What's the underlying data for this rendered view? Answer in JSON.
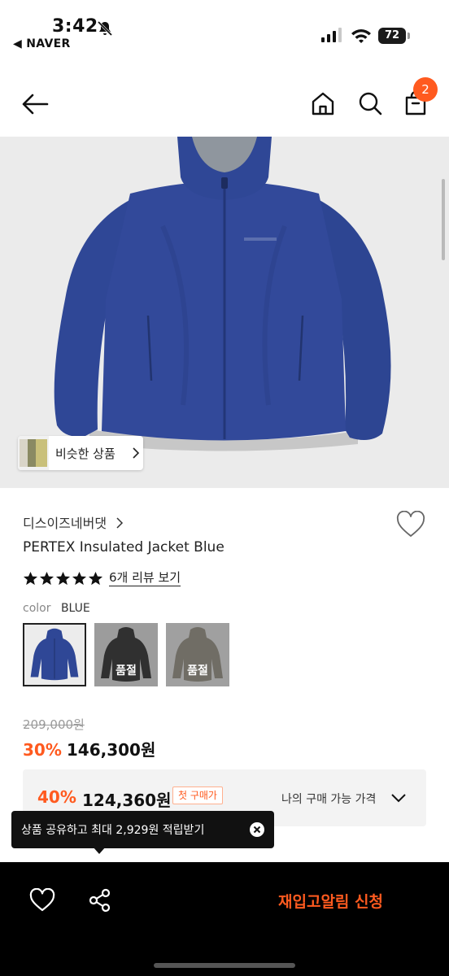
{
  "status_bar": {
    "time": "3:42",
    "back_app": "◀ NAVER",
    "battery": "72"
  },
  "header": {
    "cart_count": "2",
    "icons": [
      "back-arrow-icon",
      "home-icon",
      "search-icon",
      "shopping-bag-icon"
    ]
  },
  "hero": {
    "similar_label": "비슷한 상품"
  },
  "product": {
    "brand": "디스이즈네버댓",
    "name": "PERTEX Insulated Jacket Blue",
    "rating_stars": 5,
    "review_link": "6개 리뷰 보기",
    "color_key": "color",
    "color_value": "BLUE",
    "swatches": [
      {
        "color": "blue",
        "sold_out": ""
      },
      {
        "color": "black",
        "sold_out": "품절"
      },
      {
        "color": "khaki",
        "sold_out": "품절"
      }
    ]
  },
  "pricing": {
    "original": "209,000원",
    "discount_pct": "30%",
    "price": "146,300원",
    "coupon_pct": "40%",
    "coupon_price": "124,360원",
    "first_purchase_tag": "첫 구매가",
    "my_price_label": "나의 구매 가능 가격"
  },
  "toast": {
    "message": "상품 공유하고 최대 2,929원 적립받기"
  },
  "bottom_bar": {
    "restock_label": "재입고알림 신청"
  },
  "colors": {
    "accent": "#ff5a1f",
    "jacket_blue": "#2f4796",
    "bottom_bar_bg": "#000000"
  }
}
